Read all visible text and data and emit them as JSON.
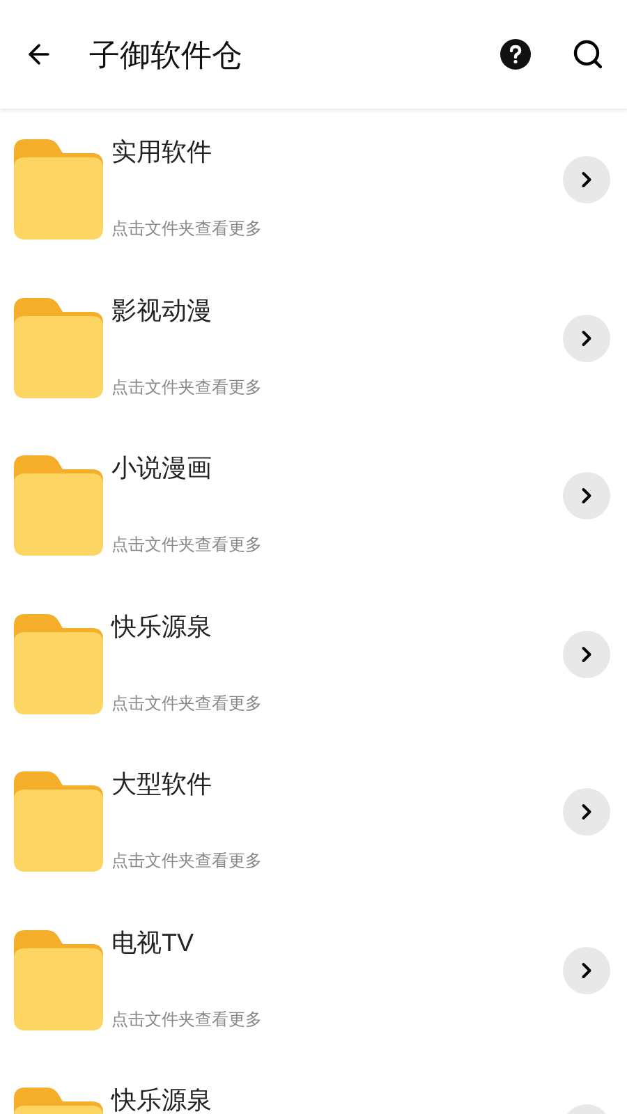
{
  "header": {
    "title": "子御软件仓"
  },
  "folders": [
    {
      "name": "实用软件",
      "hint": "点击文件夹查看更多"
    },
    {
      "name": "影视动漫",
      "hint": "点击文件夹查看更多"
    },
    {
      "name": "小说漫画",
      "hint": "点击文件夹查看更多"
    },
    {
      "name": "快乐源泉",
      "hint": "点击文件夹查看更多"
    },
    {
      "name": "大型软件",
      "hint": "点击文件夹查看更多"
    },
    {
      "name": "电视TV",
      "hint": "点击文件夹查看更多"
    },
    {
      "name": "快乐源泉"
    }
  ]
}
